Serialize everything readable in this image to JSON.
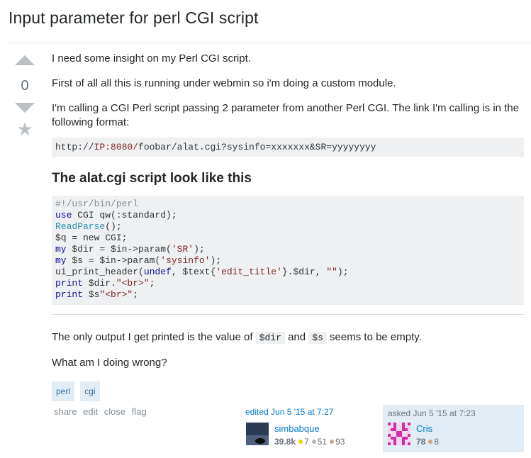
{
  "question": {
    "title": "Input parameter for perl CGI script",
    "vote_count": "0",
    "body": {
      "p1": "I need some insight on my Perl CGI script.",
      "p2": "First of all all this is running under webmin so i'm doing a custom module.",
      "p3": "I'm calling a CGI Perl script passing 2 parameter from another Perl CGI. The link I'm calling is in the following format:",
      "url_prefix": "http://",
      "url_host": "IP:8080/",
      "url_rest": "foobar/alat.cgi?sysinfo=xxxxxxx&SR=yyyyyyyy",
      "heading": "The alat.cgi script look like this",
      "code": {
        "l1": "#!/usr/bin/perl",
        "l2a": "use",
        "l2b": " CGI qw(:standard);",
        "l3a": "ReadParse",
        "l3b": "();",
        "l4": "$q = new CGI;",
        "l5a": "my",
        "l5b": " $dir = $in->param(",
        "l5c": "'SR'",
        "l5d": ");",
        "l6a": "my",
        "l6b": " $s = $in->param(",
        "l6c": "'sysinfo'",
        "l6d": ");",
        "l7a": "ui_print_header(",
        "l7b": "undef",
        "l7c": ", $text{",
        "l7d": "'edit_title'",
        "l7e": "}.$dir, ",
        "l7f": "\"\"",
        "l7g": ");",
        "l8a": "print",
        "l8b": " $dir.",
        "l8c": "\"<br>\"",
        "l8d": ";",
        "l9a": "print",
        "l9b": " $s",
        "l9c": "\"<br>\"",
        "l9d": ";"
      },
      "p4a": "The only output I get printed is the value of ",
      "p4_code1": "$dir",
      "p4b": " and ",
      "p4_code2": "$s",
      "p4c": " seems to be empty.",
      "p5": "What am I doing wrong?"
    },
    "tags": [
      "perl",
      "cgi"
    ],
    "menu": [
      "share",
      "edit",
      "close",
      "flag"
    ],
    "edited": {
      "label": "edited Jun 5 '15 at 7:27",
      "user": "simbabque",
      "rep": "39.8k",
      "gold": "7",
      "silver": "51",
      "bronze": "93"
    },
    "asked": {
      "label": "asked Jun 5 '15 at 7:23",
      "user": "Cris",
      "rep": "78",
      "bronze": "8"
    }
  },
  "colors": {
    "link": "#0077cc",
    "tag_bg": "#e1ecf4",
    "tag_text": "#39739d",
    "code_bg": "#eff0f1",
    "gold": "#ffcc01",
    "silver": "#b4b8bc",
    "bronze": "#d1a684"
  }
}
